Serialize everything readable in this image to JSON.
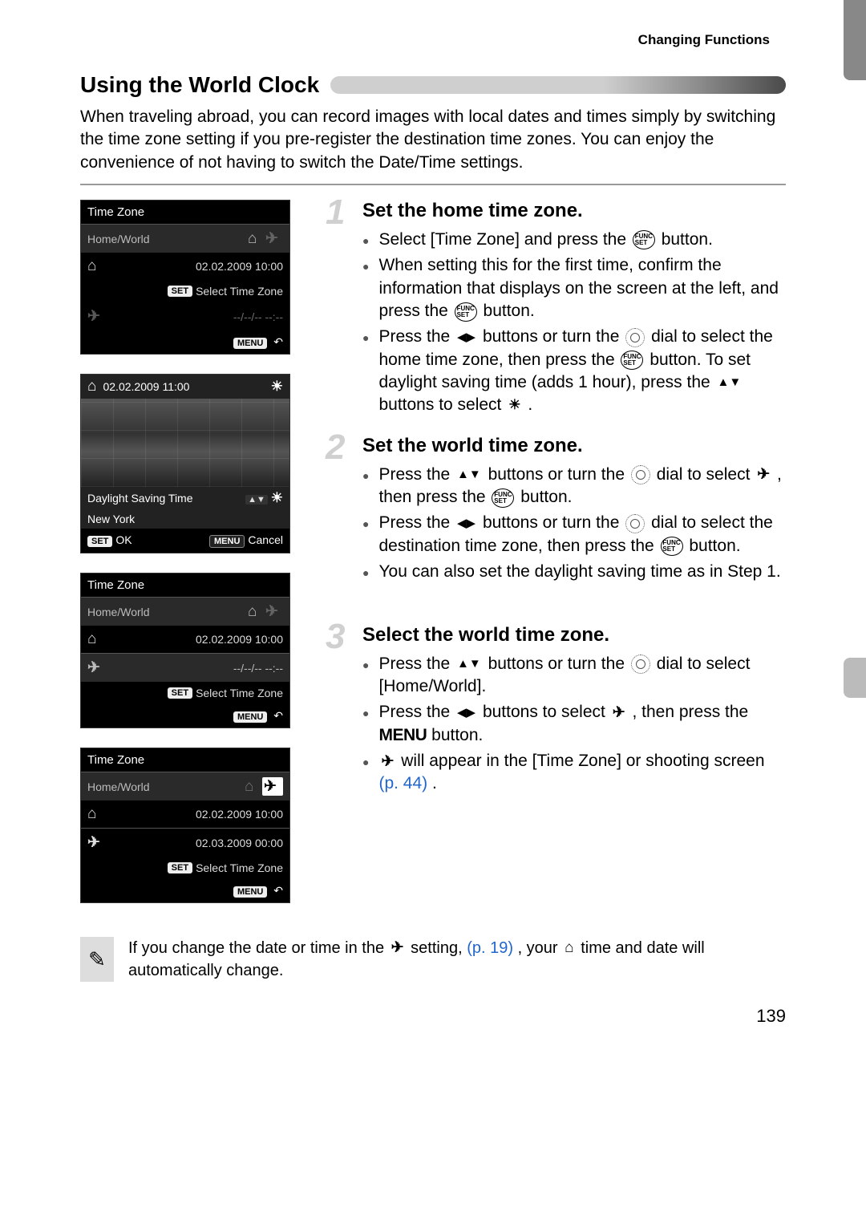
{
  "header": {
    "section": "Changing Functions"
  },
  "title": "Using the World Clock",
  "intro": "When traveling abroad, you can record images with local dates and times simply by switching the time zone setting if you pre-register the destination time zones. You can enjoy the convenience of not having to switch the Date/Time settings.",
  "screens": {
    "s1": {
      "title": "Time Zone",
      "homeWorld": "Home/World",
      "date": "02.02.2009 10:00",
      "setLabel": "SET",
      "selectTZ": "Select Time Zone",
      "menu": "MENU",
      "placeholder": "--/--/-- --:--"
    },
    "s2": {
      "topDate": "02.02.2009 11:00",
      "dst": "Daylight Saving Time",
      "city": "New York",
      "setOK": "SET",
      "ok": "OK",
      "menu": "MENU",
      "cancel": "Cancel"
    },
    "s3": {
      "title": "Time Zone",
      "homeWorld": "Home/World",
      "date": "02.02.2009 10:00",
      "placeholder": "--/--/-- --:--",
      "setLabel": "SET",
      "selectTZ": "Select Time Zone",
      "menu": "MENU"
    },
    "s4": {
      "title": "Time Zone",
      "homeWorld": "Home/World",
      "date1": "02.02.2009 10:00",
      "date2": "02.03.2009 00:00",
      "setLabel": "SET",
      "selectTZ": "Select Time Zone",
      "menu": "MENU"
    }
  },
  "steps": {
    "s1": {
      "num": "1",
      "title": "Set the home time zone.",
      "b1a": "Select [Time Zone] and press the ",
      "b1b": " button.",
      "b2a": "When setting this for the first time, confirm the information that displays on the screen at the left, and press the ",
      "b2b": " button.",
      "b3a": "Press the ",
      "b3b": " buttons or turn the ",
      "b3c": " dial to select the home time zone, then press the ",
      "b3d": " button. To set daylight saving time (adds 1 hour), press the ",
      "b3e": " buttons to select ",
      "b3f": "."
    },
    "s2": {
      "num": "2",
      "title": "Set the world time zone.",
      "b1a": "Press the ",
      "b1b": " buttons or turn the ",
      "b1c": " dial to select ",
      "b1d": ", then press the ",
      "b1e": " button.",
      "b2a": "Press the ",
      "b2b": " buttons or turn the ",
      "b2c": " dial to select the destination time zone, then press the ",
      "b2d": " button.",
      "b3": "You can also set the daylight saving time as in Step 1."
    },
    "s3": {
      "num": "3",
      "title": "Select the world time zone.",
      "b1a": "Press the ",
      "b1b": " buttons or turn the ",
      "b1c": " dial to select [Home/World].",
      "b2a": "Press the ",
      "b2b": " buttons to select ",
      "b2c": ", then press the ",
      "b2d": " button.",
      "menuWord": "MENU",
      "b3a": " will appear in the [Time Zone] or shooting screen ",
      "b3b": "(p. 44)",
      "b3c": "."
    }
  },
  "note": {
    "t1": "If you change the date or time in the ",
    "t2": " setting, ",
    "link": "(p. 19)",
    "t3": ", your ",
    "t4": " time and date will automatically change."
  },
  "pageNumber": "139",
  "funcSet": "FUNC\nSET"
}
